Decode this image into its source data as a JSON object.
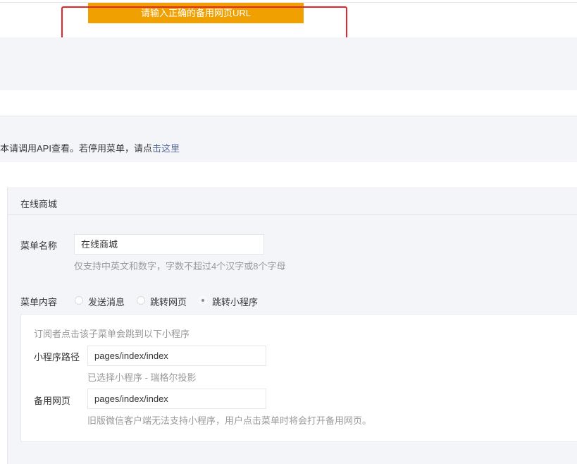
{
  "toast": {
    "message": "请输入正确的备用网页URL"
  },
  "notice": {
    "text": "本请调用API查看。若停用菜单，请点",
    "link": "击这里"
  },
  "panel": {
    "title": "在线商城",
    "menu_name": {
      "label": "菜单名称",
      "value": "在线商城",
      "hint": "仅支持中英文和数字，字数不超过4个汉字或8个字母"
    },
    "menu_content": {
      "label": "菜单内容",
      "options": [
        {
          "label": "发送消息",
          "checked": false
        },
        {
          "label": "跳转网页",
          "checked": false
        },
        {
          "label": "跳转小程序",
          "checked": true
        }
      ]
    },
    "miniprogram": {
      "desc": "订阅者点击该子菜单会跳到以下小程序",
      "path_label": "小程序路径",
      "path_value": "pages/index/index",
      "selected_hint": "已选择小程序 - 瑞格尔投影",
      "backup_label": "备用网页",
      "backup_value": "pages/index/index",
      "backup_hint": "旧版微信客户端无法支持小程序，用户点击菜单时将会打开备用网页。"
    }
  }
}
